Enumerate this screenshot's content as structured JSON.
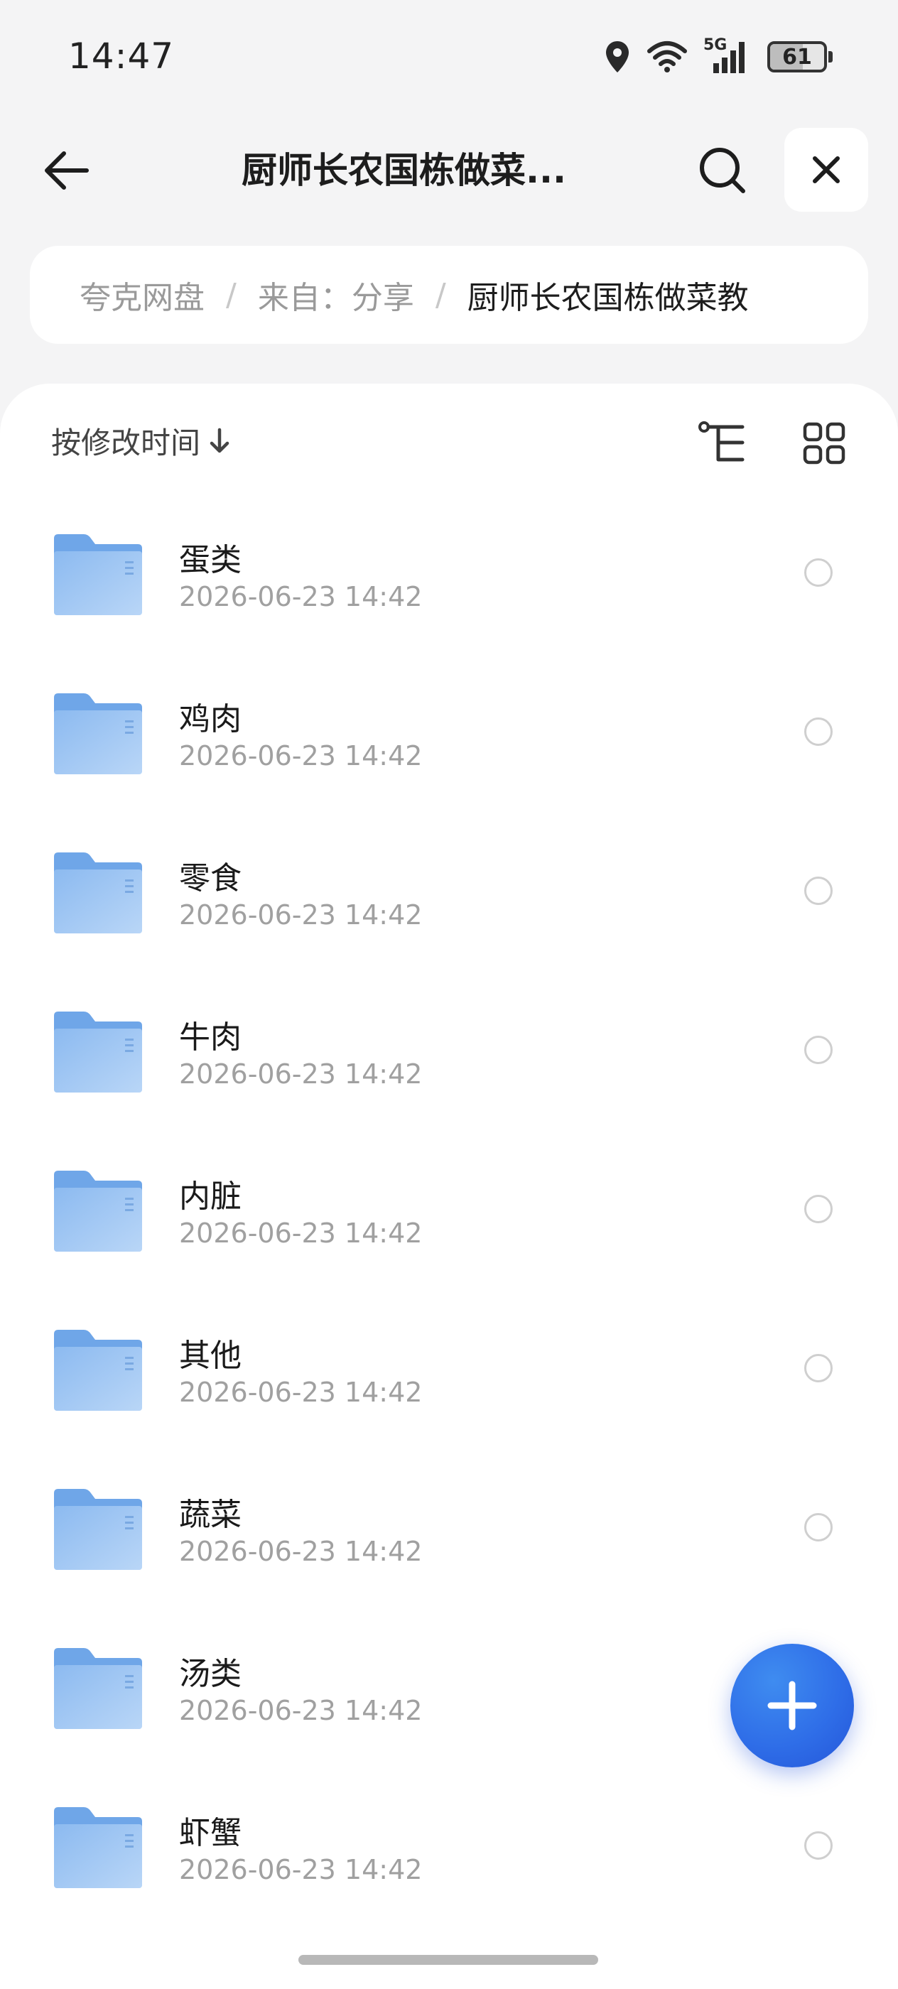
{
  "status_bar": {
    "time": "14:47",
    "network": "5G",
    "battery": "61",
    "battery_level": 0.61
  },
  "header": {
    "title": "厨师长农国栋做菜...",
    "back_icon": "arrow-left-icon",
    "search_icon": "search-icon",
    "close_icon": "close-icon"
  },
  "breadcrumb": {
    "items": [
      "夸克网盘",
      "来自：分享",
      "厨师长农国栋做菜教"
    ],
    "separator": "/"
  },
  "toolbar": {
    "sort_label": "按修改时间",
    "sort_icon": "arrow-down-icon",
    "tree_icon": "tree-structure-icon",
    "grid_icon": "grid-view-icon"
  },
  "files": [
    {
      "name": "蛋类",
      "date": "2026-06-23 14:42"
    },
    {
      "name": "鸡肉",
      "date": "2026-06-23 14:42"
    },
    {
      "name": "零食",
      "date": "2026-06-23 14:42"
    },
    {
      "name": "牛肉",
      "date": "2026-06-23 14:42"
    },
    {
      "name": "内脏",
      "date": "2026-06-23 14:42"
    },
    {
      "name": "其他",
      "date": "2026-06-23 14:42"
    },
    {
      "name": "蔬菜",
      "date": "2026-06-23 14:42"
    },
    {
      "name": "汤类",
      "date": "2026-06-23 14:42"
    },
    {
      "name": "虾蟹",
      "date": "2026-06-23 14:42"
    }
  ],
  "fab": {
    "icon": "plus-icon"
  },
  "colors": {
    "accent": "#2f6ee8",
    "folder": "#8fbdf0",
    "background": "#f4f4f5"
  }
}
